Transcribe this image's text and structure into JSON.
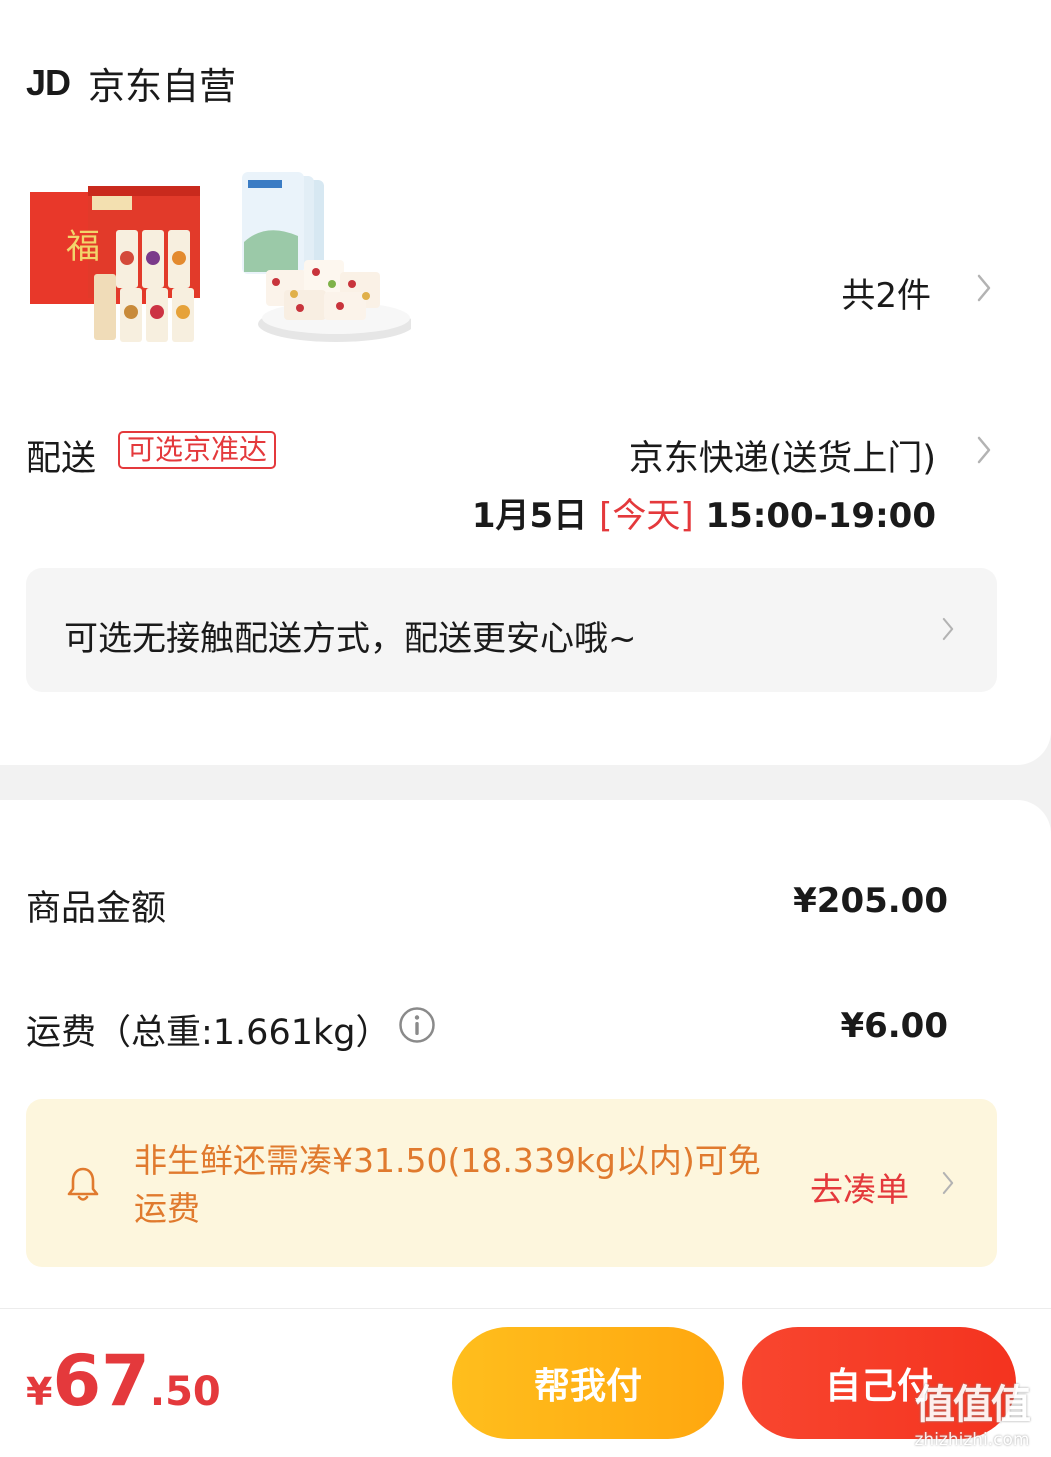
{
  "store": {
    "logo": "JD",
    "name": "京东自营"
  },
  "items": {
    "count_label": "共2件"
  },
  "shipping": {
    "label": "配送",
    "badge": "可选京准达",
    "method": "京东快递(送货上门)",
    "date": "1月5日",
    "today": "[今天]",
    "time_window": "15:00-19:00"
  },
  "contactless": {
    "text": "可选无接触配送方式，配送更安心哦~"
  },
  "summary": {
    "goods_label": "商品金额",
    "goods_value": "¥205.00",
    "freight_label": "运费（总重:1.661kg）",
    "freight_value": "¥6.00"
  },
  "notice": {
    "text": "非生鲜还需凑¥31.50(18.339kg以内)可免运费",
    "link": "去凑单"
  },
  "footer": {
    "currency": "¥",
    "total_int": "67",
    "total_dec": ".50",
    "help_pay": "帮我付",
    "self_pay": "自己付"
  },
  "watermark": {
    "logo": "值值值",
    "site": "zhizhizhi.com"
  },
  "colors": {
    "accent_red": "#e4393c",
    "notice_orange": "#e07a2e",
    "help_btn": "#ffb216",
    "self_btn": "#f53d26"
  }
}
